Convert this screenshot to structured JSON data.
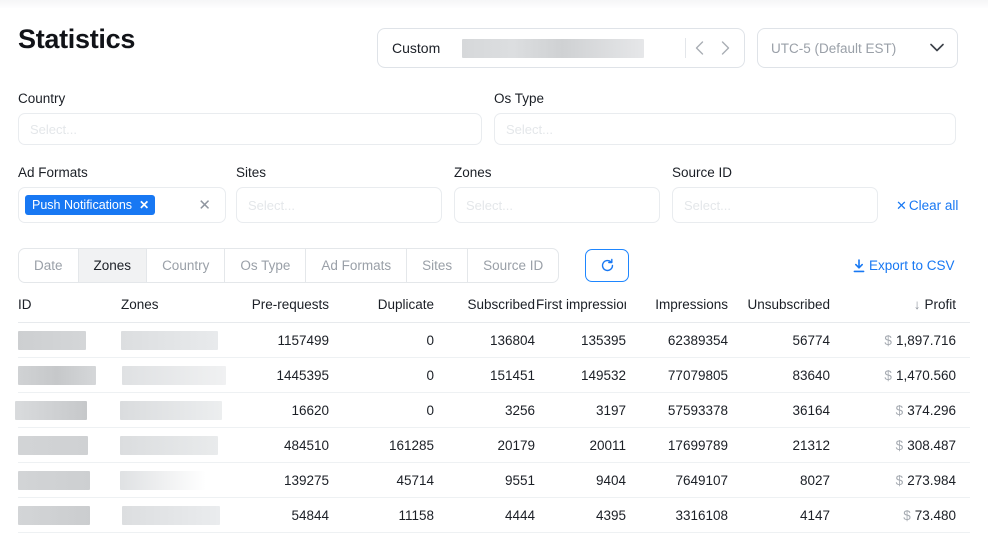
{
  "header": {
    "title": "Statistics",
    "date_range": {
      "label": "Custom",
      "value_redacted": true,
      "prev_icon": "chevron-left-icon",
      "next_icon": "chevron-right-icon"
    },
    "timezone": {
      "value": "UTC-5 (Default EST)",
      "caret_icon": "chevron-down-icon"
    }
  },
  "filters": {
    "row1": [
      {
        "label": "Country",
        "placeholder": "Select..."
      },
      {
        "label": "Os Type",
        "placeholder": "Select..."
      }
    ],
    "row2": [
      {
        "label": "Ad Formats",
        "chip": "Push Notifications",
        "chip_remove_icon": "close-icon",
        "clear_icon": "close-icon"
      },
      {
        "label": "Sites",
        "placeholder": "Select..."
      },
      {
        "label": "Zones",
        "placeholder": "Select..."
      },
      {
        "label": "Source ID",
        "placeholder": "Select..."
      }
    ],
    "clear_all": "Clear all",
    "clear_all_icon": "close-icon"
  },
  "tabs": {
    "items": [
      {
        "label": "Date",
        "active": false
      },
      {
        "label": "Zones",
        "active": true
      },
      {
        "label": "Country",
        "active": false
      },
      {
        "label": "Os Type",
        "active": false
      },
      {
        "label": "Ad Formats",
        "active": false
      },
      {
        "label": "Sites",
        "active": false
      },
      {
        "label": "Source ID",
        "active": false
      }
    ],
    "refresh_icon": "refresh-icon"
  },
  "export": {
    "label": "Export to CSV",
    "icon": "download-icon"
  },
  "table": {
    "columns": [
      {
        "key": "id",
        "label": "ID",
        "align": "left"
      },
      {
        "key": "zones",
        "label": "Zones",
        "align": "left"
      },
      {
        "key": "prerequests",
        "label": "Pre-requests",
        "align": "right"
      },
      {
        "key": "duplicate",
        "label": "Duplicate",
        "align": "right"
      },
      {
        "key": "subscribed",
        "label": "Subscribed",
        "align": "right"
      },
      {
        "key": "first_impression",
        "label": "First impression",
        "align": "right"
      },
      {
        "key": "impressions",
        "label": "Impressions",
        "align": "right"
      },
      {
        "key": "unsubscribed",
        "label": "Unsubscribed",
        "align": "right"
      },
      {
        "key": "profit",
        "label": "Profit",
        "align": "right",
        "sorted": "desc",
        "sort_icon": "arrow-down-icon"
      }
    ],
    "currency_symbol": "$",
    "rows": [
      {
        "id": "",
        "zones": "",
        "prerequests": "1157499",
        "duplicate": "0",
        "subscribed": "136804",
        "first_impression": "135395",
        "impressions": "62389354",
        "unsubscribed": "56774",
        "profit": "1,897.716"
      },
      {
        "id": "",
        "zones": "",
        "prerequests": "1445395",
        "duplicate": "0",
        "subscribed": "151451",
        "first_impression": "149532",
        "impressions": "77079805",
        "unsubscribed": "83640",
        "profit": "1,470.560"
      },
      {
        "id": "",
        "zones": "",
        "prerequests": "16620",
        "duplicate": "0",
        "subscribed": "3256",
        "first_impression": "3197",
        "impressions": "57593378",
        "unsubscribed": "36164",
        "profit": "374.296"
      },
      {
        "id": "",
        "zones": "",
        "prerequests": "484510",
        "duplicate": "161285",
        "subscribed": "20179",
        "first_impression": "20011",
        "impressions": "17699789",
        "unsubscribed": "21312",
        "profit": "308.487"
      },
      {
        "id": "",
        "zones": "",
        "prerequests": "139275",
        "duplicate": "45714",
        "subscribed": "9551",
        "first_impression": "9404",
        "impressions": "7649107",
        "unsubscribed": "8027",
        "profit": "273.984"
      },
      {
        "id": "",
        "zones": "",
        "prerequests": "54844",
        "duplicate": "11158",
        "subscribed": "4444",
        "first_impression": "4395",
        "impressions": "3316108",
        "unsubscribed": "4147",
        "profit": "73.480"
      }
    ]
  },
  "colors": {
    "accent_blue": "#1878f3",
    "chip_blue": "#1878f3",
    "text_dark": "#1b1f26",
    "muted": "#9aa0a8",
    "border": "#e4e7ea"
  }
}
